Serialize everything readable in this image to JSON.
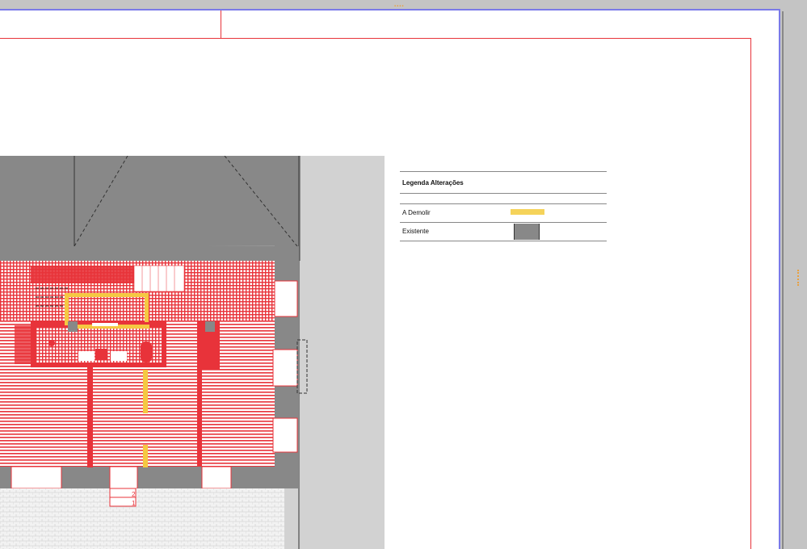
{
  "legend": {
    "title": "Legenda Alterações",
    "items": [
      {
        "label": "A Demolir",
        "swatch_color": "#f5d35a"
      },
      {
        "label": "Existente",
        "swatch_color": "#888888"
      }
    ]
  },
  "plan": {
    "stair_numbers": [
      "2",
      "1"
    ]
  },
  "colors": {
    "existing": "#888888",
    "demolish": "#f5c842",
    "new": "#e8333a",
    "viewport_bg": "#d2d2d2"
  }
}
